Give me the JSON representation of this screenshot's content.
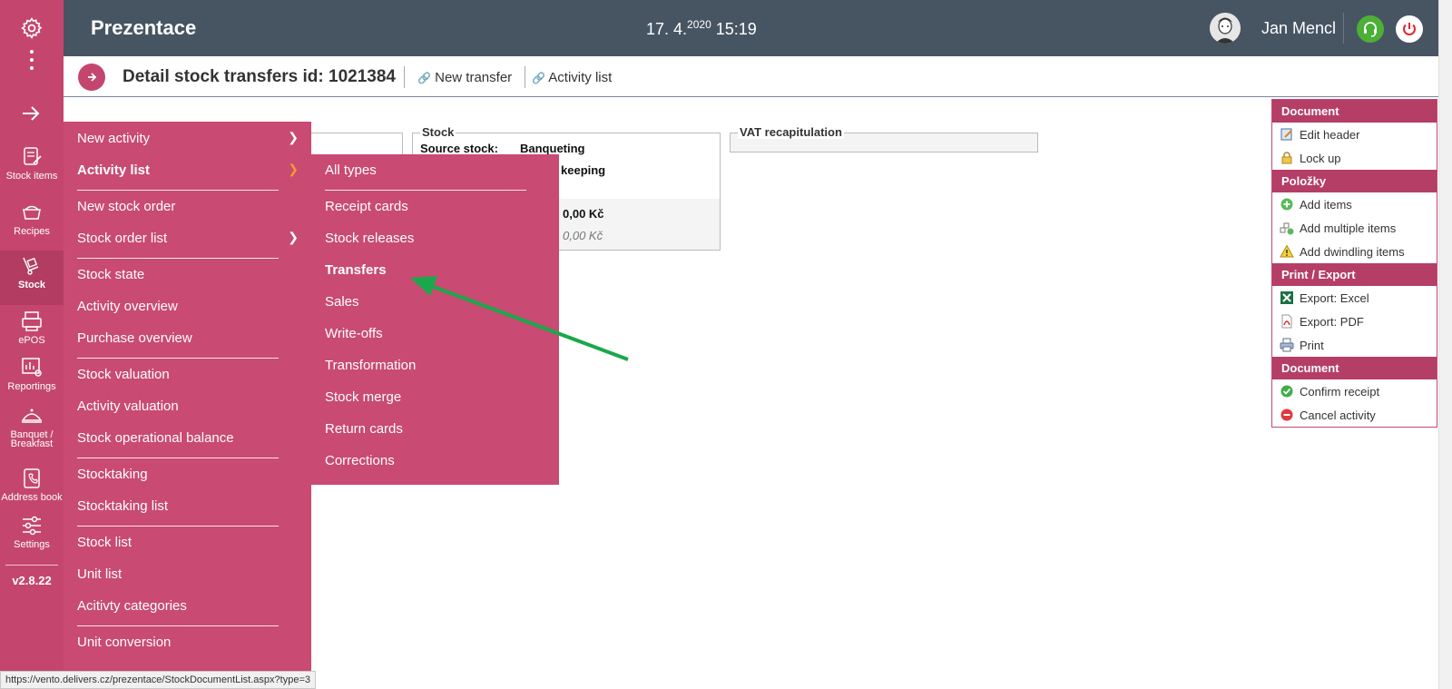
{
  "header": {
    "app_title": "Prezentace",
    "date": "17. 4.",
    "year": "2020",
    "time": "15:19",
    "user_name": "Jan Mencl"
  },
  "rail": {
    "items": [
      {
        "label": "Stock items",
        "icon": "stock-items-icon"
      },
      {
        "label": "Recipes",
        "icon": "recipes-icon"
      },
      {
        "label": "Stock",
        "icon": "stock-icon"
      },
      {
        "label": "ePOS",
        "icon": "epos-icon"
      },
      {
        "label": "Reportings",
        "icon": "reportings-icon"
      },
      {
        "label": "Banquet /",
        "label2": "Breakfast",
        "icon": "banquet-icon"
      },
      {
        "label": "Address book",
        "icon": "address-book-icon"
      },
      {
        "label": "Settings",
        "icon": "settings-icon"
      }
    ],
    "version": "v2.8.22"
  },
  "page": {
    "title": "Detail stock transfers id: 1021384",
    "new_transfer": "New transfer",
    "activity_list": "Activity list"
  },
  "stock_box": {
    "legend": "Stock",
    "source_label": "Source stock:",
    "source_value": "Banqueting",
    "target_partial": "keeping",
    "amount": "0,00 Kč",
    "amount2": "0,00 Kč"
  },
  "vat_box": {
    "legend": "VAT recapitulation"
  },
  "menu1": {
    "items": [
      "New activity",
      "Activity list",
      "New stock order",
      "Stock order list",
      "Stock state",
      "Activity overview",
      "Purchase overview",
      "Stock valuation",
      "Activity valuation",
      "Stock operational balance",
      "Stocktaking",
      "Stocktaking list",
      "Stock list",
      "Unit list",
      "Acitivty categories",
      "Unit conversion"
    ]
  },
  "menu2": {
    "items": [
      "All types",
      "Receipt cards",
      "Stock releases",
      "Transfers",
      "Sales",
      "Write-offs",
      "Transformation",
      "Stock merge",
      "Return cards",
      "Corrections"
    ]
  },
  "sidepanel": {
    "sections": [
      {
        "title": "Document",
        "items": [
          "Edit header",
          "Lock up"
        ]
      },
      {
        "title": "Položky",
        "items": [
          "Add items",
          "Add multiple items",
          "Add dwindling items"
        ]
      },
      {
        "title": "Print / Export",
        "items": [
          "Export: Excel",
          "Export: PDF",
          "Print"
        ]
      },
      {
        "title": "Document",
        "items": [
          "Confirm receipt",
          "Cancel activity"
        ]
      }
    ]
  },
  "status_url": "https://vento.delivers.cz/prezentace/StockDocumentList.aspx?type=3",
  "colors": {
    "header_bg": "#475563",
    "accent": "#c4466f",
    "menu_bg": "#c94a72",
    "arrow": "#1aa84a"
  }
}
